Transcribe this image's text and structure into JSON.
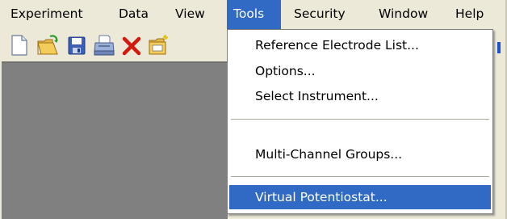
{
  "menubar": {
    "items": [
      {
        "label": "Experiment"
      },
      {
        "label": "Data"
      },
      {
        "label": "View"
      },
      {
        "label": "Tools",
        "active": true
      },
      {
        "label": "Security"
      },
      {
        "label": "Window"
      },
      {
        "label": "Help"
      }
    ]
  },
  "toolbar": {
    "buttons": [
      "new-document-icon",
      "open-folder-icon",
      "save-icon",
      "print-icon",
      "delete-icon",
      "new-folder-icon"
    ]
  },
  "tools_menu": {
    "items": [
      {
        "label": "Reference Electrode List..."
      },
      {
        "label": "Options..."
      },
      {
        "label": "Select Instrument..."
      },
      {
        "label": "Multi-Channel Groups..."
      },
      {
        "label": "Virtual Potentiostat...",
        "selected": true
      }
    ]
  },
  "colors": {
    "highlight": "#316ac5",
    "window_bg": "#ece9d8",
    "mdi_bg": "#808080"
  }
}
